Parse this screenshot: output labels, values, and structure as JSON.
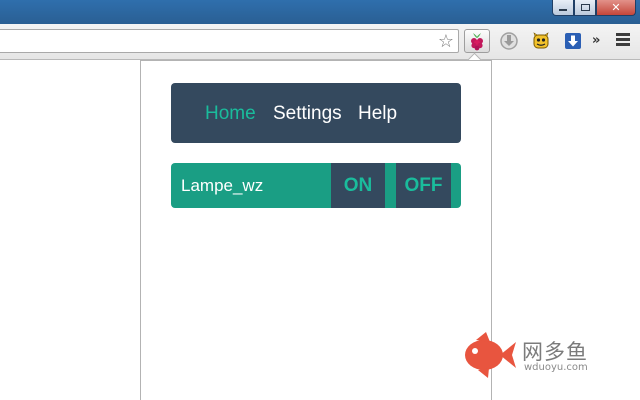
{
  "browser": {
    "window_controls": [
      "minimize",
      "maximize",
      "close"
    ],
    "omnibox_value": "",
    "extensions": [
      "raspberry-extension",
      "gray-extension",
      "monster-extension",
      "download-extension"
    ],
    "overflow_label": "»"
  },
  "popup": {
    "nav": {
      "items": [
        {
          "label": "Home",
          "active": true
        },
        {
          "label": "Settings",
          "active": false
        },
        {
          "label": "Help",
          "active": false
        }
      ]
    },
    "devices": [
      {
        "name": "Lampe_wz",
        "on_label": "ON",
        "off_label": "OFF"
      }
    ]
  },
  "colors": {
    "nav_bg": "#34495e",
    "accent": "#1abc9c",
    "device_bg": "#1a9e84",
    "titlebar": "#2f6fad"
  },
  "watermark": {
    "brand": "网多鱼",
    "url": "wduoyu.com"
  }
}
